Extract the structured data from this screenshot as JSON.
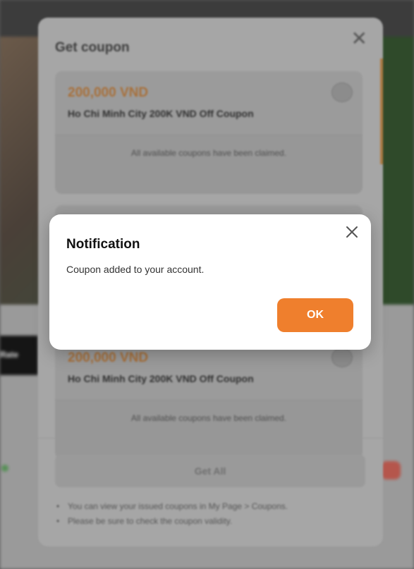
{
  "background": {
    "tab_label": "Rate"
  },
  "coupon_modal": {
    "title": "Get coupon",
    "coupons": [
      {
        "amount": "200,000 VND",
        "name": "Ho Chi Minh City 200K VND Off Coupon",
        "status": "All available coupons have been claimed."
      },
      {
        "amount": "200,000 VND",
        "name": "Ho Chi Minh City 200K VND Off Coupon",
        "status": "All available coupons have been claimed."
      }
    ],
    "get_all_label": "Get All",
    "notes": [
      "You can view your issued coupons in My Page > Coupons.",
      "Please be sure to check the coupon validity."
    ]
  },
  "notification": {
    "title": "Notification",
    "message": "Coupon added to your account.",
    "ok_label": "OK"
  },
  "colors": {
    "accent": "#ef7f2d",
    "overlay": "#5a5a5a"
  }
}
